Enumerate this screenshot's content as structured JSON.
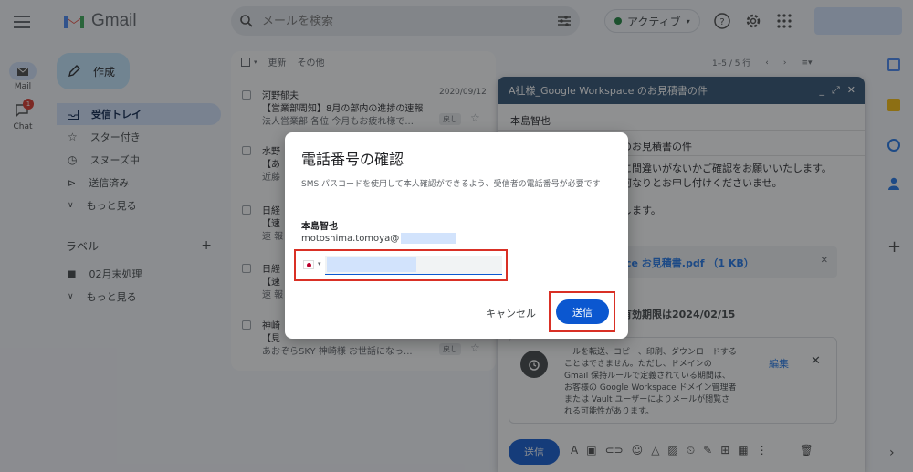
{
  "app": {
    "name": "Gmail"
  },
  "search": {
    "placeholder": "メールを検索"
  },
  "status": {
    "label": "アクティブ"
  },
  "rail": {
    "mail": "Mail",
    "chat": "Chat",
    "chat_badge": "1"
  },
  "sidebar": {
    "compose": "作成",
    "items": [
      {
        "label": "受信トレイ"
      },
      {
        "label": "スター付き"
      },
      {
        "label": "スヌーズ中"
      },
      {
        "label": "送信済み"
      },
      {
        "label": "もっと見る"
      }
    ],
    "labels_title": "ラベル",
    "labels": [
      {
        "label": "02月末処理"
      },
      {
        "label": "もっと見る"
      }
    ]
  },
  "list_toolbar": {
    "refresh": "更新",
    "more": "その他"
  },
  "pager": {
    "range": "1–5 / 5 行"
  },
  "emails": [
    {
      "sender": "河野郁夫",
      "subject": "【営業部周知】8月の部内の進捗の速報",
      "snippet": "法人営業部 各位 今月もお疲れ様で...",
      "date": "2020/09/12",
      "tag": "戻し"
    },
    {
      "sender": "水野",
      "subject": "【あ",
      "snippet": "近藤",
      "date": "",
      "tag": ""
    },
    {
      "sender": "日経",
      "subject": "【速",
      "snippet": "速 報",
      "date": "",
      "tag": ""
    },
    {
      "sender": "日経",
      "subject": "【速",
      "snippet": "速 報",
      "date": "",
      "tag": ""
    },
    {
      "sender": "神崎",
      "subject": "【見",
      "snippet": "あおぞらSKY 神崎様 お世話になっ...",
      "date": "",
      "tag": "戻し"
    }
  ],
  "compose_window": {
    "title": "A社様_Google Workspace のお見積書の件",
    "ctrl_min": "_",
    "ctrl_expand": "⤢",
    "ctrl_close": "✕",
    "to": "本島智也",
    "subject_partial": "のお見積書の件",
    "body_line1": "に間違いがないかご確認をお願いいたします。",
    "body_line2": "何なりとお申し付けくださいませ。",
    "body_line3": "します。",
    "attachment": "ce お見積書.pdf （1 KB）",
    "expiry": "有効期限は2024/02/15",
    "notice": "ールを転送、コピー、印刷、ダウンロードすることはできません。ただし、ドメインの Gmail 保持ルールで定義されている期間は、お客様の Google Workspace ドメイン管理者または Vault ユーザーによりメールが閲覧される可能性があります。",
    "edit": "編集",
    "close": "✕",
    "send": "送信"
  },
  "dialog": {
    "title": "電話番号の確認",
    "description": "SMS パスコードを使用して本人確認ができるよう、受信者の電話番号が必要です",
    "recipient_name": "本島智也",
    "recipient_email": "motoshima.tomoya@",
    "phone_value": "",
    "cancel": "キャンセル",
    "send": "送信"
  },
  "colors": {
    "accent": "#0b57d0",
    "highlight": "#d93025",
    "header": "#2b4c6f"
  }
}
